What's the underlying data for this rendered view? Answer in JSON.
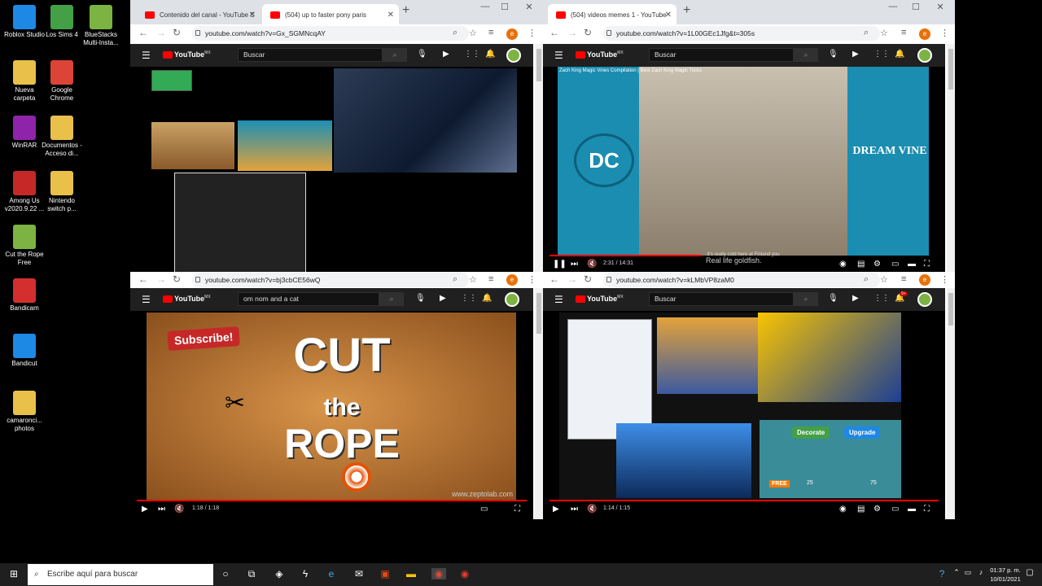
{
  "desktop": {
    "icons": [
      {
        "label": "Roblox Studio",
        "icon": "roblox-icon",
        "color": "#1e88e5"
      },
      {
        "label": "Los Sims 4",
        "icon": "sims-icon",
        "color": "#43a047"
      },
      {
        "label": "BlueStacks Multi-Insta...",
        "icon": "bluestacks-icon",
        "color": "#7cb342"
      },
      {
        "label": "Nueva carpeta",
        "icon": "folder-icon",
        "color": "#e8c04a"
      },
      {
        "label": "Google Chrome",
        "icon": "chrome-icon",
        "color": "#db4437"
      },
      {
        "label": "WinRAR",
        "icon": "winrar-icon",
        "color": "#8e24aa"
      },
      {
        "label": "Documentos - Acceso di...",
        "icon": "documents-shortcut-icon",
        "color": "#e8c04a"
      },
      {
        "label": "Among Us v2020.9.22 ...",
        "icon": "among-us-icon",
        "color": "#c62828"
      },
      {
        "label": "Nintendo switch p...",
        "icon": "nintendo-folder-icon",
        "color": "#e8c04a"
      },
      {
        "label": "Cut the Rope Free",
        "icon": "cut-the-rope-icon",
        "color": "#7cb342"
      },
      {
        "label": "Bandicam",
        "icon": "bandicam-icon",
        "color": "#d32f2f"
      },
      {
        "label": "Bandicut",
        "icon": "bandicut-icon",
        "color": "#1e88e5"
      },
      {
        "label": "camaronci... photos",
        "icon": "photos-folder-icon",
        "color": "#e8c04a"
      }
    ]
  },
  "browser_top_left": {
    "tabs": [
      {
        "label": "Contenido del canal - YouTube S"
      },
      {
        "label": "(504) up to faster pony paris"
      }
    ],
    "url": "youtube.com/watch?v=Gx_SGMNcqAY",
    "search_placeholder": "Buscar",
    "search_btn": "⌕"
  },
  "browser_top_right": {
    "tabs": [
      {
        "label": "(504) videos memes 1 - YouTube"
      }
    ],
    "url": "youtube.com/watch?v=1L00GEc1Jfg&t=305s",
    "search_placeholder": "Buscar",
    "video_title": "Zach King Magic Vines Compilation | Best Zach King Magic Tricks",
    "overlay_left": "DC",
    "overlay_right": "DREAM VINE",
    "subtitle": "It's really cold here at Finland you",
    "time": "2:31 / 14:31",
    "caption_below": "Real life goldfish."
  },
  "browser_bottom_left": {
    "url": "youtube.com/watch?v=bj3cbCE56wQ",
    "search_value": "om nom and a cat",
    "subscribe_label": "Subscribe!",
    "title_line1": "CUT",
    "title_line2": "the",
    "title_line3": "ROPE",
    "time": "1:18 / 1:18",
    "watermark": "www.zeptolab.com"
  },
  "browser_bottom_right": {
    "url": "youtube.com/watch?v=kLMbVP8zaM0",
    "search_placeholder": "Buscar",
    "time": "1:14 / 1:15",
    "btn_decorate": "Decorate",
    "btn_upgrade": "Upgrade",
    "label_free": "FREE",
    "count_a": "25",
    "count_b": "75",
    "notif_badge": "9+"
  },
  "taskbar": {
    "search_placeholder": "Escribe aquí para buscar",
    "time": "01:37 p. m.",
    "date": "10/01/2021"
  },
  "colors": {
    "yt_red": "#ff0000",
    "taskbar": "#1f1f1f",
    "chrome_tabbar": "#dee1e6"
  }
}
